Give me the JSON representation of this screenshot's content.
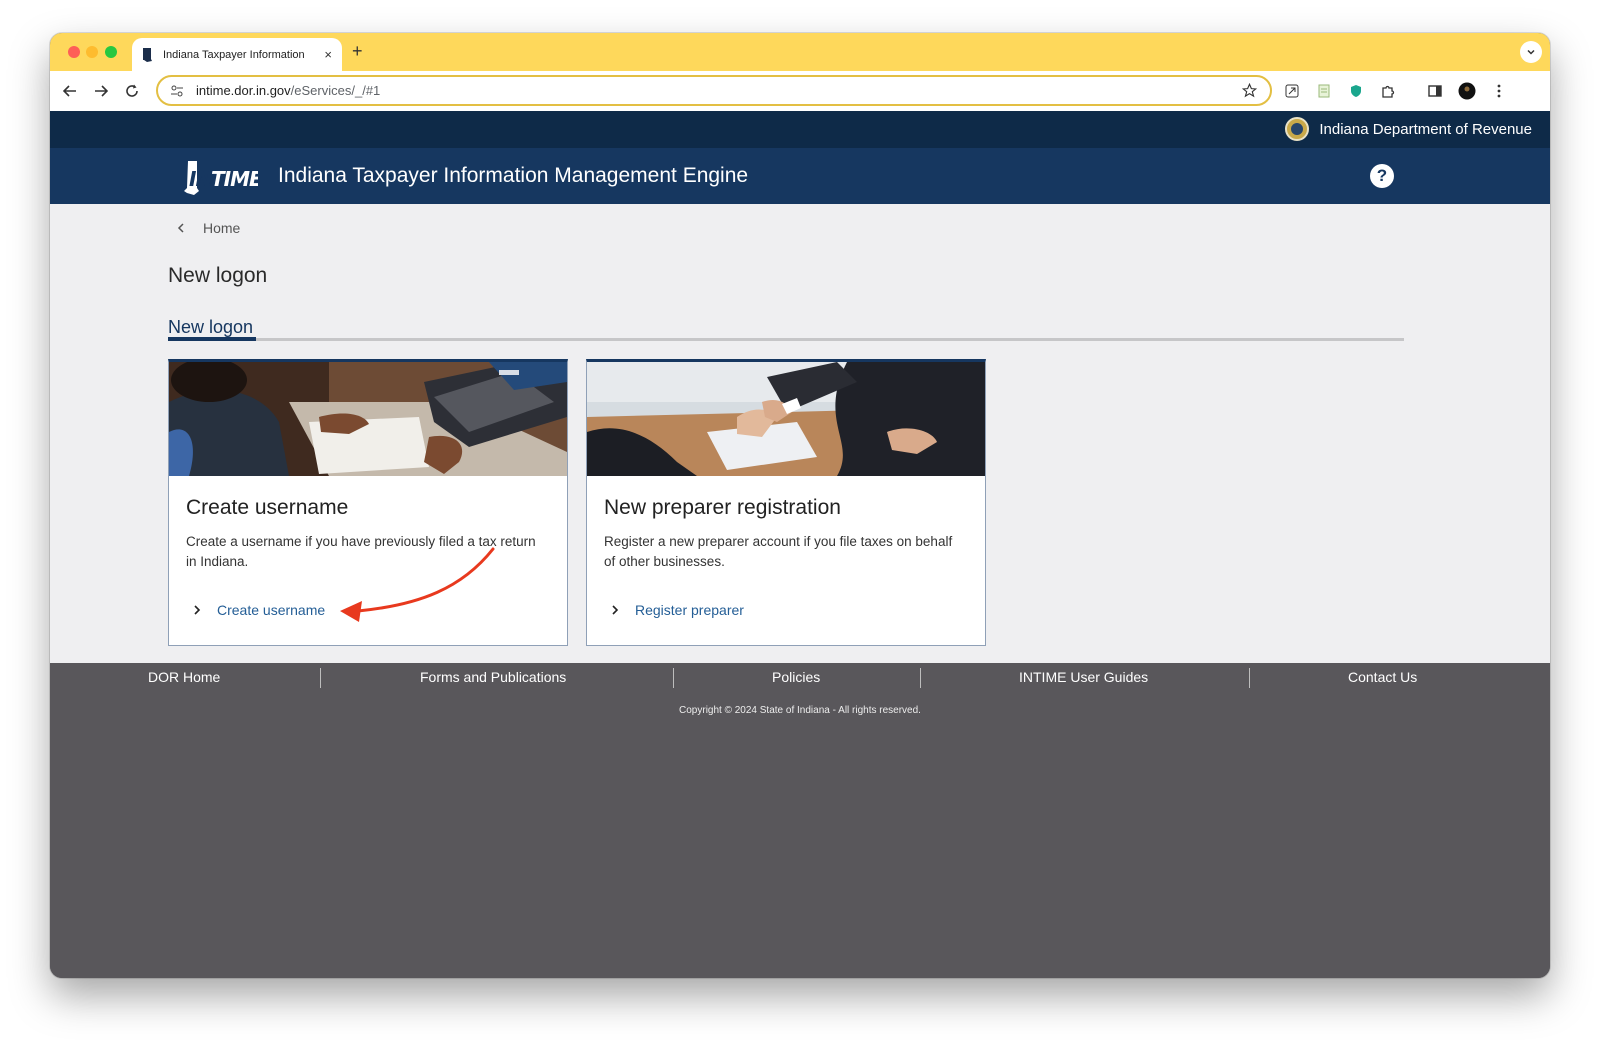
{
  "browser": {
    "tab_title": "Indiana Taxpayer Information",
    "new_tab": "+",
    "tab_close": "×",
    "url_host": "intime.dor.in.gov",
    "url_path": "/eServices/_/#1",
    "accent": "#fed85b"
  },
  "site": {
    "department": "Indiana Department of Revenue",
    "app_title": "Indiana Taxpayer Information Management Engine",
    "logo_text": "INTIME",
    "help": "?",
    "header_color": "#163760"
  },
  "page": {
    "breadcrumb": "Home",
    "title": "New logon",
    "active_tab": "New logon"
  },
  "cards": [
    {
      "title": "Create username",
      "description": "Create a username if you have previously filed a tax return in Indiana.",
      "link": "Create username",
      "image": "woman-typing-on-laptop"
    },
    {
      "title": "New preparer registration",
      "description": "Register a new preparer account if you file taxes on behalf of other businesses.",
      "link": "Register preparer",
      "image": "business-handshake"
    }
  ],
  "footer": {
    "links": [
      "DOR Home",
      "Forms and Publications",
      "Policies",
      "INTIME User Guides",
      "Contact Us"
    ],
    "copyright": "Copyright © 2024 State of Indiana - All rights reserved."
  },
  "annotation": {
    "color": "#e8391e",
    "target": "Create username"
  }
}
